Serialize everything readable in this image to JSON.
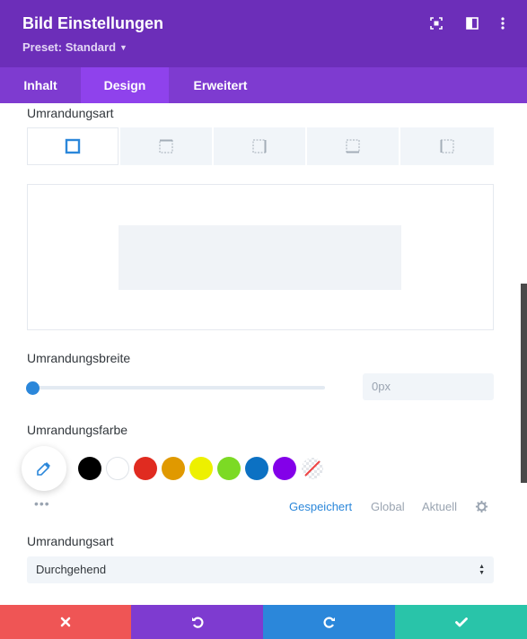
{
  "header": {
    "title": "Bild Einstellungen",
    "preset": "Preset: Standard",
    "icons": [
      "focus-icon",
      "split-view-icon",
      "kebab-menu-icon"
    ],
    "color": "#6c2eb9"
  },
  "tabs": [
    {
      "label": "Inhalt",
      "active": false
    },
    {
      "label": "Design",
      "active": true
    },
    {
      "label": "Erweitert",
      "active": false
    }
  ],
  "border_type": {
    "label": "Umrandungsart",
    "options": [
      "all-sides-icon",
      "top-border-icon",
      "right-border-icon",
      "bottom-border-icon",
      "left-border-icon"
    ],
    "selected": "all-sides-icon"
  },
  "border_width": {
    "label": "Umrandungsbreite",
    "value_placeholder": "0px",
    "slider_value": 0
  },
  "border_color": {
    "label": "Umrandungsfarbe",
    "swatches": [
      "#000000",
      "#ffffff",
      "#e02b20",
      "#e09900",
      "#edf000",
      "#7cda24",
      "#0c71c3",
      "#8300e9",
      "none"
    ],
    "preset_links": [
      "Gespeichert",
      "Global",
      "Aktuell"
    ],
    "active_link": "Gespeichert"
  },
  "border_style": {
    "label": "Umrandungsart",
    "value": "Durchgehend"
  },
  "footer": {
    "buttons": [
      {
        "icon": "close-icon",
        "color": "#ef5555"
      },
      {
        "icon": "undo-icon",
        "color": "#7e3bd0"
      },
      {
        "icon": "redo-icon",
        "color": "#2b87da"
      },
      {
        "icon": "check-icon",
        "color": "#29c4a9"
      }
    ]
  }
}
